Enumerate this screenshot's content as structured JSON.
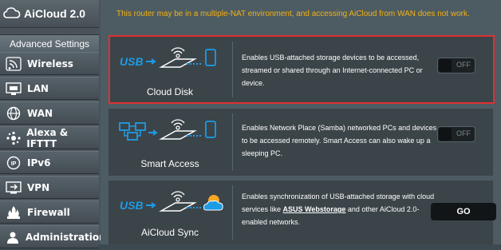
{
  "sidebar": {
    "top_item": "AiCloud 2.0",
    "section_header": "Advanced Settings",
    "items": [
      {
        "label": "Wireless",
        "icon": "wireless-icon"
      },
      {
        "label": "LAN",
        "icon": "lan-icon"
      },
      {
        "label": "WAN",
        "icon": "wan-globe-icon"
      },
      {
        "label": "Alexa & IFTTT",
        "icon": "alexa-icon"
      },
      {
        "label": "IPv6",
        "icon": "ipv6-icon"
      },
      {
        "label": "VPN",
        "icon": "vpn-icon"
      },
      {
        "label": "Firewall",
        "icon": "firewall-icon"
      },
      {
        "label": "Administration",
        "icon": "administration-icon"
      }
    ]
  },
  "warning": {
    "line2": "This router may be in a multiple-NAT environment, and accessing AiCloud from WAN does not work."
  },
  "cards": [
    {
      "label": "Cloud Disk",
      "description": "Enables USB-attached storage devices to be accessed, streamed or shared through an Internet-connected PC or device.",
      "toggle": "OFF"
    },
    {
      "label": "Smart Access",
      "description": "Enables Network Place (Samba) networked PCs and devices to be accessed remotely. Smart Access can also wake up a sleeping PC.",
      "toggle": "OFF"
    },
    {
      "label": "AiCloud Sync",
      "desc_before": "Enables synchronization of USB-attached storage with cloud services like ",
      "desc_link": "ASUS Webstorage",
      "desc_after": " and other AiCloud 2.0-enabled networks.",
      "button": "GO"
    }
  ],
  "colors": {
    "warning_text": "#f5b111",
    "highlight_border": "#e03030",
    "card_bg": "#3b4449",
    "sidebar_bg": "#4a5359",
    "icon_blue": "#1e9be6"
  }
}
